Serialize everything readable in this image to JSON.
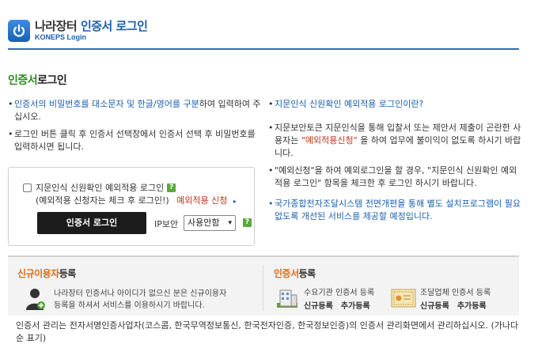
{
  "header": {
    "brand_main": "나라장터",
    "brand_accent": "인증서 로그인",
    "brand_sub": "KONEPS Login",
    "accent_color": "#1b5fab"
  },
  "page": {
    "title_accent": "인증서",
    "title_rest": "로그인"
  },
  "left_notes": [
    {
      "pre": "인증서의 비밀번호를 대소문자 및 한글/영어를 구분",
      "post": "하여 입력하여 주십시오."
    },
    {
      "text": "로그인 버튼 클릭 후 인증서 선택창에서 인증서 선택 후 비밀번호를 입력하시면 됩니다."
    }
  ],
  "right_notes": {
    "question_link": "지문인식 신원확인 예외적용 로그인이란?",
    "note1_pre": "지문보안토큰 지문인식을 통해 입찰서 또는 제안서 제출이 곤란한 사용자는 ",
    "note1_highlight": "\"예외적용신청\"",
    "note1_post": " 을 하여 업무에 불이익이 없도록 하시기 바랍니다.",
    "note2": "\"예외신청\"을 하여 예외로그인을 할 경우, \"지문인식 신원확인 예외적용 로그인\" 항목을 체크한 후 로그인 하시기 바랍니다.",
    "note3": "국가종합전자조달시스템 전면개편을 통해 별도 설치프로그램이 필요 없도록 개선된 서비스를 제공할 예정입니다."
  },
  "login_box": {
    "checkbox_label": "지문인식 신원확인 예외적용 로그인",
    "help_badge": "?",
    "sub_text": "(예외적용 신청자는 체크 후 로그인!)",
    "apply_link": "예외적용 신청",
    "arrow_glyph": "▸",
    "login_button": "인증서 로그인",
    "ip_label": "IP보안",
    "ip_select_value": "사용안함",
    "select_caret": "▾",
    "checkbox_checked": false
  },
  "register": {
    "user_title_accent": "신규이용자",
    "user_title_rest": "등록",
    "user_text_line1": "나라장터 인증서나 아이디가 없으신 분은 신규이용자",
    "user_text_line2": "등록을 하셔서 서비스를 이용하시기 바랍니다.",
    "cert_title_accent": "인증서",
    "cert_title_rest": "등록",
    "org_label": "수요기관 인증서 등록",
    "org_new": "신규등록",
    "org_add": "추가등록",
    "sup_label": "조달업체 인증서 등록",
    "sup_new": "신규등록",
    "sup_add": "추가등록",
    "orange_color": "#e06a12"
  },
  "footer": {
    "text": "인증서 관리는 전자서명인증사업자(코스콤, 한국무역정보통신, 한국전자인증, 한국정보인증)의 인증서 관리화면에서 관리하십시오. (가나다순 표기)"
  }
}
